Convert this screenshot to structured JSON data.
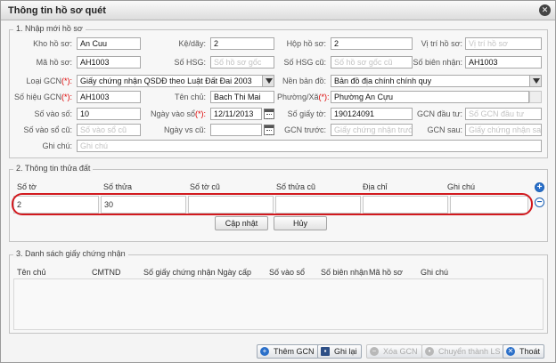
{
  "window": {
    "title": "Thông tin hồ sơ quét"
  },
  "section1": {
    "legend": "1. Nhập mới hồ sơ",
    "row1": {
      "kho_label": "Kho hồ sơ:",
      "kho_value": "An Cuu",
      "ke_label": "Kệ/dãy:",
      "ke_value": "2",
      "hop_label": "Hộp hồ sơ:",
      "hop_value": "2",
      "vitri_label": "Vị trí hồ sơ:",
      "vitri_ph": "Vị trí hồ sơ"
    },
    "row2": {
      "ma_label": "Mã hồ sơ:",
      "ma_value": "AH1003",
      "hsg_label": "Số HSG:",
      "hsg_ph": "Số hồ sơ gốc",
      "hsgcu_label": "Số HSG cũ:",
      "hsgcu_ph": "Số hồ sơ gốc cũ",
      "bn_label": "Số biên nhận:",
      "bn_value": "AH1003"
    },
    "row3": {
      "loai_label": "Loại GCN",
      "loai_value": "Giấy chứng nhận QSDĐ theo Luật Đất Đai 2003",
      "nen_label": "Nền bản đồ:",
      "nen_value": "Bản đồ địa chính chính quy"
    },
    "row4": {
      "sohieu_label": "Số hiệu GCN",
      "sohieu_value": "AH1003",
      "tenchu_label": "Tên chủ:",
      "tenchu_value": "Bach Thi Mai",
      "phuong_label": "Phường/Xã",
      "phuong_value": "Phường An Cựu"
    },
    "row5": {
      "sovaoso_label": "Số vào số:",
      "sovaoso_value": "10",
      "ngayvaoso_label": "Ngày vào sổ",
      "ngayvaoso_value": "12/11/2013",
      "sogiayto_label": "Số giấy tờ:",
      "sogiayto_value": "190124091",
      "gcndautu_label": "GCN đầu tư:",
      "gcndautu_ph": "Số GCN đầu tư"
    },
    "row6": {
      "sovaosocu_label": "Số vào sổ cũ:",
      "sovaosocu_ph": "Số vào sổ cũ",
      "ngayvscu_label": "Ngày vs cũ:",
      "gcntruoc_label": "GCN trước:",
      "gcntruoc_ph": "Giấy chứng nhận trước",
      "gcnsau_label": "GCN sau:",
      "gcnsau_ph": "Giấy chứng nhận sau"
    },
    "row7": {
      "ghichu_label": "Ghi chú:",
      "ghichu_ph": "Ghi chú"
    },
    "required_mark": "(*):"
  },
  "section2": {
    "legend": "2. Thông tin thửa đất",
    "headers": [
      "Số tờ",
      "Số thửa",
      "Số tờ cũ",
      "Số thửa cũ",
      "Địa chỉ",
      "Ghi chú"
    ],
    "row": [
      "2",
      "30",
      "",
      "",
      "",
      ""
    ],
    "update_label": "Cập nhật",
    "cancel_label": "Hủy",
    "add_symbol": "+",
    "remove_symbol": "−"
  },
  "section3": {
    "legend": "3. Danh sách giấy chứng nhận",
    "headers": [
      "Tên chủ",
      "CMTND",
      "Số giấy chứng nhận",
      "Ngày cấp",
      "Số vào sổ",
      "Số biên nhận",
      "Mã hồ sơ",
      "Ghi chú"
    ]
  },
  "footer": {
    "add_gcn": "Thêm GCN",
    "save": "Ghi lại",
    "delete_gcn": "Xóa GCN",
    "convert": "Chuyển thành LS",
    "exit": "Thoát"
  },
  "colors": {
    "highlight": "#d2191e",
    "accent": "#2a6fc9"
  }
}
